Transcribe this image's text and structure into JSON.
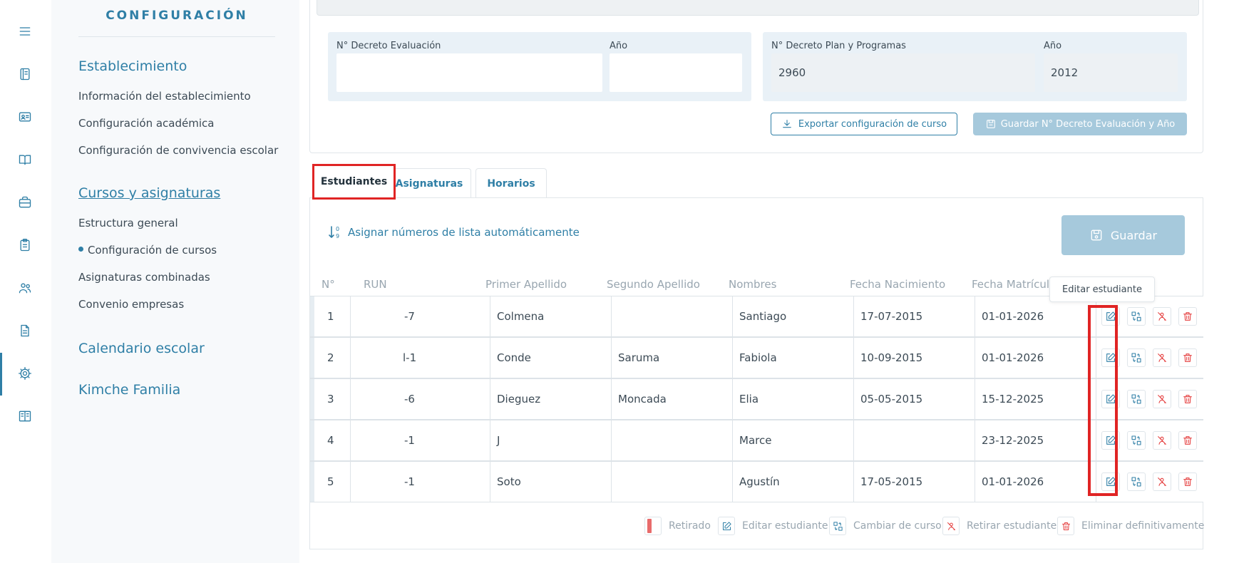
{
  "colors": {
    "accent": "#2f7fa6",
    "danger": "#e53e3e",
    "disabled_button": "#a6c9dc",
    "highlight": "#e02424"
  },
  "rail": {
    "icons": [
      "menu-icon",
      "notebook-icon",
      "id-card-icon",
      "book-open-icon",
      "briefcase-icon",
      "clipboard-icon",
      "users-icon",
      "document-icon",
      "gear-icon",
      "library-icon"
    ]
  },
  "sidebar": {
    "title": "CONFIGURACIÓN",
    "sections": [
      {
        "label": "Establecimiento",
        "items": [
          "Información del establecimiento",
          "Configuración académica",
          "Configuración de convivencia escolar"
        ]
      },
      {
        "label": "Cursos y asignaturas",
        "items": [
          "Estructura general",
          "Configuración de cursos",
          "Asignaturas combinadas",
          "Convenio empresas"
        ]
      },
      {
        "label": "Calendario escolar",
        "items": []
      },
      {
        "label": "Kimche Familia",
        "items": []
      }
    ]
  },
  "decree": {
    "evaluacion": {
      "label": "N° Decreto Evaluación",
      "value": ""
    },
    "evaluacion_year": {
      "label": "Año",
      "value": ""
    },
    "plan": {
      "label": "N° Decreto Plan y Programas",
      "value": "2960"
    },
    "plan_year": {
      "label": "Año",
      "value": "2012"
    },
    "export_label": "Exportar configuración de curso",
    "save_label": "Guardar N° Decreto Evaluación y Año"
  },
  "tabs": [
    "Estudiantes",
    "Asignaturas",
    "Horarios"
  ],
  "students": {
    "auto_number_label": "Asignar números de lista automáticamente",
    "save_label": "Guardar",
    "tooltip": "Editar estudiante",
    "columns": [
      "N°",
      "RUN",
      "Primer Apellido",
      "Segundo Apellido",
      "Nombres",
      "Fecha Nacimiento",
      "Fecha Matrícula"
    ],
    "rows": [
      {
        "n": "1",
        "run": "-7",
        "apellido1": "Colmena",
        "apellido2": "",
        "nombres": "Santiago",
        "nacimiento": "17-07-2015",
        "matricula": "01-01-2026"
      },
      {
        "n": "2",
        "run": "l-1",
        "apellido1": "Conde",
        "apellido2": "Saruma",
        "nombres": "Fabiola",
        "nacimiento": "10-09-2015",
        "matricula": "01-01-2026"
      },
      {
        "n": "3",
        "run": "-6",
        "apellido1": "Dieguez",
        "apellido2": "Moncada",
        "nombres": "Elia",
        "nacimiento": "05-05-2015",
        "matricula": "15-12-2025"
      },
      {
        "n": "4",
        "run": "-1",
        "apellido1": "J",
        "apellido2": "",
        "nombres": "Marce",
        "nacimiento": "",
        "matricula": "23-12-2025"
      },
      {
        "n": "5",
        "run": "-1",
        "apellido1": "Soto",
        "apellido2": "",
        "nombres": "Agustín",
        "nacimiento": "17-05-2015",
        "matricula": "01-01-2026"
      }
    ],
    "row_actions": [
      "edit-student-icon",
      "change-course-icon",
      "withdraw-student-icon",
      "trash-icon"
    ]
  },
  "legend": {
    "retirado": "Retirado",
    "editar": "Editar estudiante",
    "cambiar": "Cambiar de curso",
    "retirar": "Retirar estudiante",
    "eliminar": "Eliminar definitivamente"
  }
}
